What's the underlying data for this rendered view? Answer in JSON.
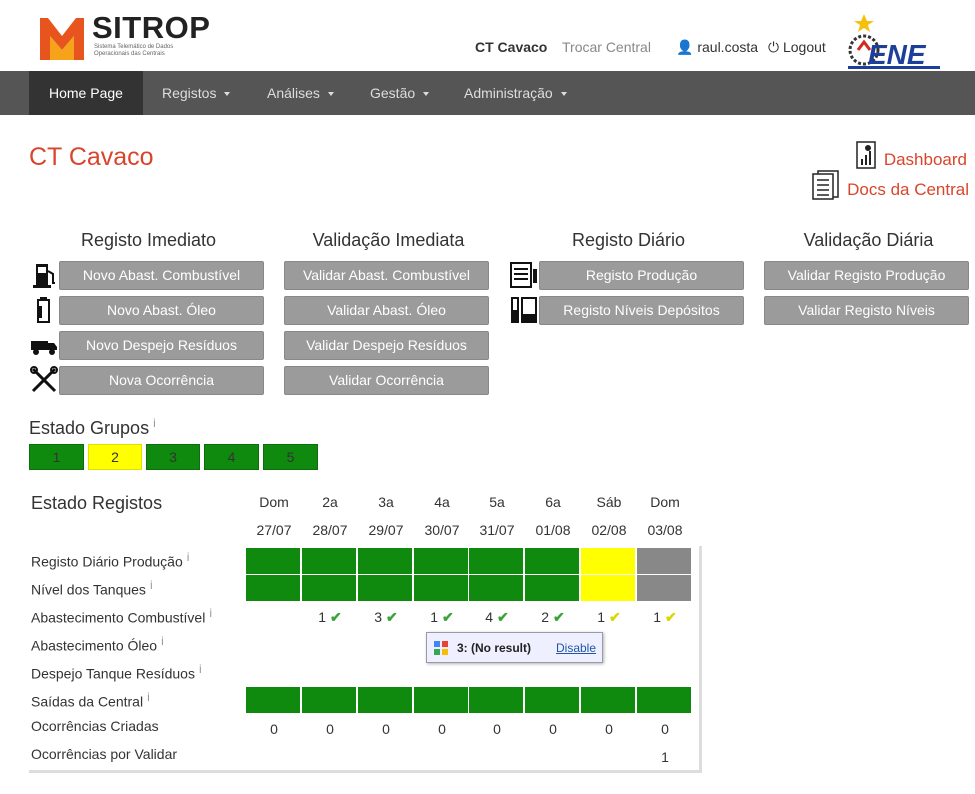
{
  "header": {
    "logo_text": "SITROP",
    "logo_subtitle": "Sistema Telemático de Dados Operacionais das Centrais",
    "central_name": "CT Cavaco",
    "switch_central": "Trocar Central",
    "user": "raul.costa",
    "logout": "Logout",
    "brand_logo": "ENE"
  },
  "nav": {
    "items": [
      {
        "label": "Home Page"
      },
      {
        "label": "Registos"
      },
      {
        "label": "Análises"
      },
      {
        "label": "Gestão"
      },
      {
        "label": "Administração"
      }
    ]
  },
  "page": {
    "title": "CT Cavaco",
    "dashboard_link": "Dashboard",
    "docs_link": "Docs da Central"
  },
  "sections": {
    "registo_imediato": {
      "title": "Registo Imediato",
      "buttons": [
        "Novo Abast. Combustível",
        "Novo Abast. Óleo",
        "Novo Despejo Resíduos",
        "Nova Ocorrência"
      ]
    },
    "validacao_imediata": {
      "title": "Validação Imediata",
      "buttons": [
        "Validar Abast. Combustível",
        "Validar Abast. Óleo",
        "Validar Despejo Resíduos",
        "Validar Ocorrência"
      ]
    },
    "registo_diario": {
      "title": "Registo Diário",
      "buttons": [
        "Registo Produção",
        "Registo Níveis Depósitos"
      ]
    },
    "validacao_diaria": {
      "title": "Validação Diária",
      "buttons": [
        "Validar Registo Produção",
        "Validar Registo Níveis"
      ]
    }
  },
  "estado_grupos": {
    "title": "Estado Grupos",
    "info": "i",
    "groups": [
      {
        "label": "1",
        "status": "green"
      },
      {
        "label": "2",
        "status": "yellow"
      },
      {
        "label": "3",
        "status": "green"
      },
      {
        "label": "4",
        "status": "green"
      },
      {
        "label": "5",
        "status": "green"
      }
    ]
  },
  "estado_registos": {
    "title": "Estado Registos",
    "days": [
      "Dom",
      "2a",
      "3a",
      "4a",
      "5a",
      "6a",
      "Sáb",
      "Dom"
    ],
    "dates": [
      "27/07",
      "28/07",
      "29/07",
      "30/07",
      "31/07",
      "01/08",
      "02/08",
      "03/08"
    ],
    "rows": [
      {
        "label": "Registo Diário Produção",
        "info": "i"
      },
      {
        "label": "Nível dos Tanques",
        "info": "i"
      },
      {
        "label": "Abastecimento Combustível",
        "info": "i"
      },
      {
        "label": "Abastecimento Óleo",
        "info": "i"
      },
      {
        "label": "Despejo Tanque Resíduos",
        "info": "i"
      },
      {
        "label": "Saídas da Central",
        "info": "i"
      },
      {
        "label": "Ocorrências Criadas"
      },
      {
        "label": "Ocorrências por Validar"
      }
    ],
    "producao_status": [
      "green",
      "green",
      "green",
      "green",
      "green",
      "green",
      "yellow",
      "gray"
    ],
    "tanques_status": [
      "green",
      "green",
      "green",
      "green",
      "green",
      "green",
      "yellow",
      "gray"
    ],
    "combustivel_counts": [
      "",
      "1",
      "3",
      "1",
      "4",
      "2",
      "1",
      "1"
    ],
    "combustivel_check": [
      "",
      "green",
      "green",
      "green",
      "green",
      "green",
      "yellow",
      "yellow"
    ],
    "saidas_status": [
      "green",
      "green",
      "green",
      "green",
      "green",
      "green",
      "green",
      "green"
    ],
    "ocorrencias_criadas": [
      "0",
      "0",
      "0",
      "0",
      "0",
      "0",
      "0",
      "0"
    ],
    "ocorrencias_por_validar": [
      "",
      "",
      "",
      "",
      "",
      "",
      "",
      "1"
    ]
  },
  "popup": {
    "text": "3: (No result)",
    "action": "Disable"
  }
}
